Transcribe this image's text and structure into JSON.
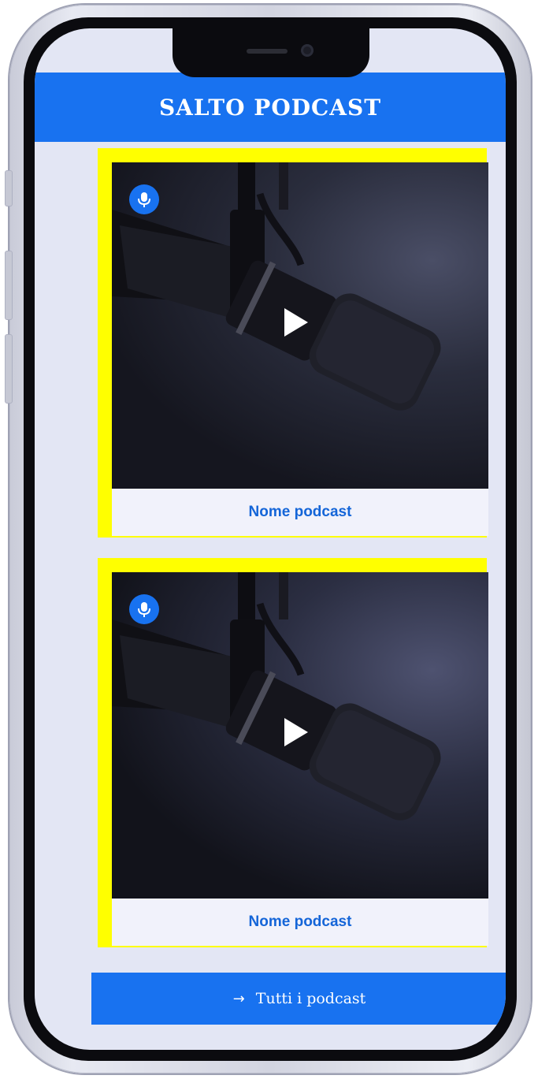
{
  "app": {
    "title": "SALTO PODCAST"
  },
  "podcasts": [
    {
      "label": "Nome podcast",
      "badge_icon": "microphone-icon",
      "overlay_icon": "play-icon"
    },
    {
      "label": "Nome podcast",
      "badge_icon": "microphone-icon",
      "overlay_icon": "play-icon"
    }
  ],
  "footer_button": {
    "label": "Tutti i podcast",
    "icon": "arrow-right-icon",
    "arrow_glyph": "→"
  },
  "colors": {
    "accent": "#1872f0",
    "card_highlight": "#ffff00",
    "label_text": "#1465d8",
    "screen_background": "#e3e6f4"
  }
}
